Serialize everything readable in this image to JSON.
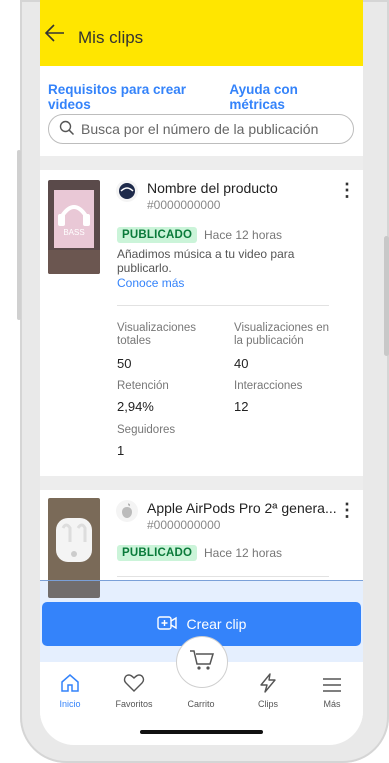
{
  "header": {
    "title": "Mis clips",
    "back_icon": "back-arrow-icon",
    "bg_color": "#ffe600"
  },
  "links": {
    "requirements": "Requisitos para crear videos",
    "metrics_help": "Ayuda con métricas"
  },
  "search": {
    "placeholder": "Busca por el número de la publicación",
    "icon": "search-icon"
  },
  "clips": [
    {
      "product_name": "Nombre del producto",
      "publication_number": "#0000000000",
      "status": "PUBLICADO",
      "time": "Hace 12 horas",
      "note": "Añadimos música a tu video para publicarlo.",
      "learn_more": "Conoce más",
      "metrics": {
        "views_total_label": "Visualizaciones totales",
        "views_total_value": "50",
        "views_pub_label": "Visualizaciones en la publicación",
        "views_pub_value": "40",
        "retention_label": "Retención",
        "retention_value": "2,94%",
        "interactions_label": "Interacciones",
        "interactions_value": "12",
        "followers_label": "Seguidores",
        "followers_value": "1"
      }
    },
    {
      "product_name": "Apple AirPods Pro 2ª genera...",
      "publication_number": "#0000000000",
      "status": "PUBLICADO",
      "time": "Hace 12 horas"
    }
  ],
  "create_button": {
    "label": "Crear clip",
    "color": "#3483fa"
  },
  "tabbar": {
    "items": [
      {
        "label": "Inicio",
        "icon": "home-icon",
        "active": true
      },
      {
        "label": "Favoritos",
        "icon": "heart-icon",
        "active": false
      },
      {
        "label": "Carrito",
        "icon": "cart-icon",
        "active": false
      },
      {
        "label": "Clips",
        "icon": "bolt-icon",
        "active": false
      },
      {
        "label": "Más",
        "icon": "menu-icon",
        "active": false
      }
    ]
  },
  "colors": {
    "accent": "#3483fa",
    "status_bg": "#cbf4d9",
    "status_text": "#0a7a3a"
  }
}
